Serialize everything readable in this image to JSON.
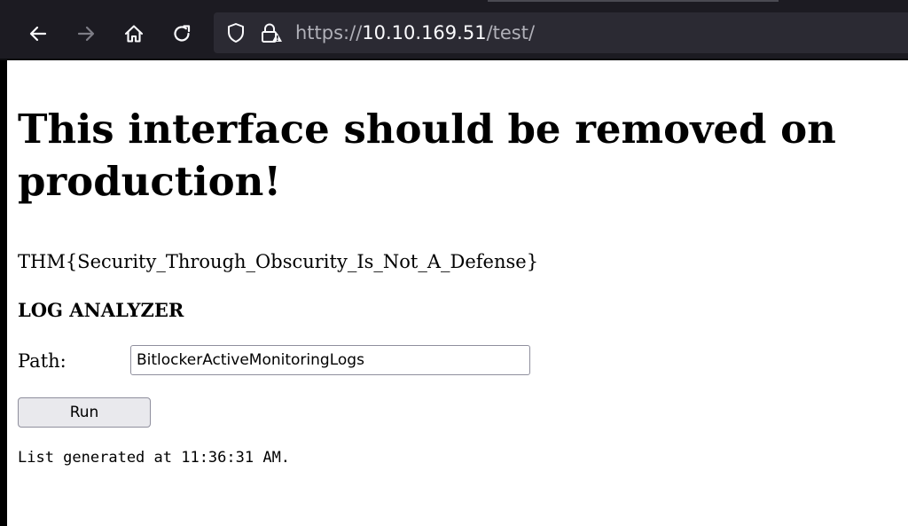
{
  "browser": {
    "icons": {
      "back": "back-arrow-icon",
      "forward": "forward-arrow-icon",
      "home": "home-icon",
      "reload": "reload-icon",
      "tracking": "shield-icon",
      "security": "insecure-lock-icon"
    },
    "url": {
      "scheme": "https://",
      "host": "10.10.169.51",
      "path": "/test/"
    }
  },
  "page": {
    "heading": "This interface should be removed on production!",
    "flag": "THM{Security_Through_Obscurity_Is_Not_A_Defense}",
    "section_title": "LOG ANALYZER",
    "form": {
      "path_label": "Path:",
      "path_value": "BitlockerActiveMonitoringLogs",
      "run_label": "Run"
    },
    "generated_text": "List generated at 11:36:31 AM."
  }
}
